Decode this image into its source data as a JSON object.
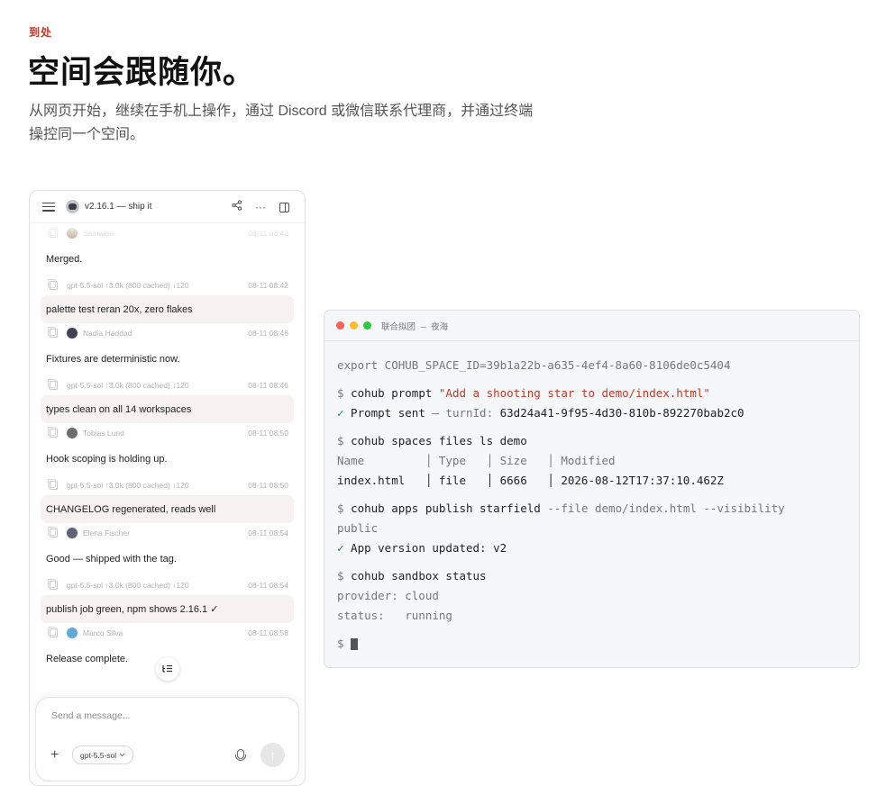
{
  "section": {
    "eyebrow": "到处",
    "title": "空间会跟随你。",
    "description": "从网页开始，继续在手机上操作，通过 Discord 或微信联系代理商，并通过终端操控同一个空间。"
  },
  "chat": {
    "title": "v2.16.1 — ship it",
    "messages": [
      {
        "meta_name": "Samwise",
        "meta_time": "08-11 08:42",
        "avatar_color": "#9c7b5b"
      },
      {
        "text": "Merged.",
        "kind": "agent"
      },
      {
        "meta_name": "gpt-5.5-sol ↑3.0k (800 cached) ↓120",
        "meta_time": "08-11 08:42"
      },
      {
        "text": "palette test reran 20x, zero flakes",
        "kind": "user"
      },
      {
        "meta_name": "Nadia Haddad",
        "meta_time": "08-11 08:46",
        "avatar_color": "#3d4555"
      },
      {
        "text": "Fixtures are deterministic now.",
        "kind": "agent"
      },
      {
        "meta_name": "gpt-5.5-sol ↑3.0k (800 cached) ↓120",
        "meta_time": "08-11 08:46"
      },
      {
        "text": "types clean on all 14 workspaces",
        "kind": "user"
      },
      {
        "meta_name": "Tobias Lund",
        "meta_time": "08-11 08:50",
        "avatar_color": "#6e6e6e"
      },
      {
        "text": "Hook scoping is holding up.",
        "kind": "agent"
      },
      {
        "meta_name": "gpt-5.5-sol ↑3.0k (800 cached) ↓120",
        "meta_time": "08-11 08:50"
      },
      {
        "text": "CHANGELOG regenerated, reads well",
        "kind": "user"
      },
      {
        "meta_name": "Elena Fischer",
        "meta_time": "08-11 08:54",
        "avatar_color": "#5b6478"
      },
      {
        "text": "Good — shipped with the tag.",
        "kind": "agent"
      },
      {
        "meta_name": "gpt-5.5-sol ↑3.0k (800 cached) ↓120",
        "meta_time": "08-11 08:54"
      },
      {
        "text": "publish job green, npm shows 2.16.1 ✓",
        "kind": "user"
      },
      {
        "meta_name": "Marco Silva",
        "meta_time": "08-11 08:58",
        "avatar_color": "#5fa8d8"
      },
      {
        "text": "Release complete.",
        "kind": "agent"
      }
    ],
    "composer": {
      "placeholder": "Send a message...",
      "model": "gpt-5.5-sol",
      "model_icon": "chevron-down-icon"
    }
  },
  "terminal": {
    "title": "联合拟团 — 夜海",
    "lines": [
      "export COHUB_SPACE_ID=39b1a22b-a635-4ef4-8a60-8106de0c5404",
      "$ cohub prompt \"Add a shooting star to demo/index.html\"",
      "✓ Prompt sent — turnId: 63d24a41-9f95-4d30-810b-892270bab2c0",
      "$ cohub spaces files ls demo",
      "Name         │ Type   │ Size   │ Modified",
      "index.html   │ file   │ 6666   │ 2026-08-12T17:37:10.462Z",
      "$ cohub apps publish starfield --file demo/index.html --visibility",
      "public",
      "✓ App version updated: v2",
      "$ cohub sandbox status",
      "provider: cloud",
      "status:   running",
      "$ "
    ],
    "colors": {
      "red": "#ff5f57",
      "yellow": "#febc2e",
      "green": "#28c840"
    }
  }
}
